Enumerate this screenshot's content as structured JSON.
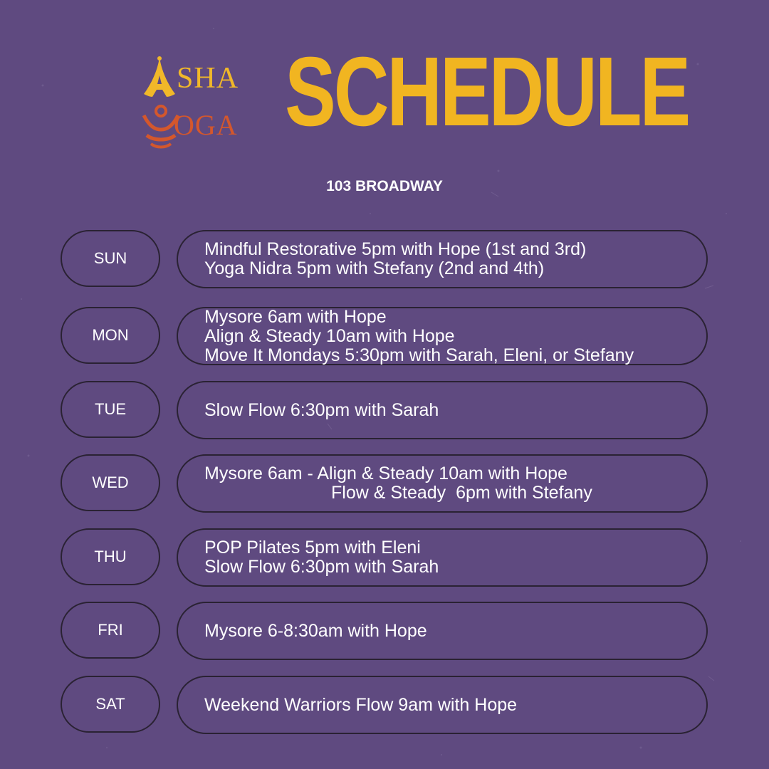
{
  "logo": {
    "word1": "SHA",
    "word2": "OGA"
  },
  "title": "SCHEDULE",
  "address": "103 BROADWAY",
  "colors": {
    "background": "#5f4a80",
    "accent": "#f1b521",
    "logo_orange": "#d4572c",
    "outline": "#2a2233"
  },
  "schedule": [
    {
      "day": "SUN",
      "classes": [
        "Mindful Restorative 5pm with Hope (1st and 3rd)",
        "Yoga Nidra 5pm with Stefany (2nd and 4th)"
      ]
    },
    {
      "day": "MON",
      "classes": [
        "Mysore 6am with Hope",
        "Align & Steady 10am with Hope",
        "Move It Mondays 5:30pm with Sarah, Eleni, or Stefany"
      ]
    },
    {
      "day": "TUE",
      "classes": [
        "Slow Flow 6:30pm with Sarah"
      ]
    },
    {
      "day": "WED",
      "classes": [
        "Mysore 6am - Align & Steady 10am with Hope",
        "Flow & Steady  6pm with Stefany"
      ]
    },
    {
      "day": "THU",
      "classes": [
        "POP Pilates 5pm with Eleni",
        "Slow Flow 6:30pm with Sarah"
      ]
    },
    {
      "day": "FRI",
      "classes": [
        "Mysore 6-8:30am with Hope"
      ]
    },
    {
      "day": "SAT",
      "classes": [
        "Weekend Warriors Flow 9am with Hope"
      ]
    }
  ]
}
